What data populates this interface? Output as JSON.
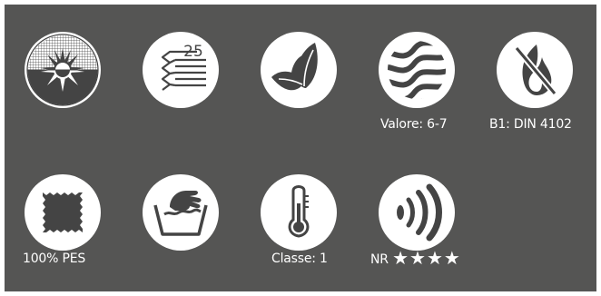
{
  "features": {
    "uv_protection": {
      "icon": "sun-mesh-icon"
    },
    "pleats": {
      "icon": "pleat-icon",
      "value": "25"
    },
    "eco": {
      "icon": "leaf-icon"
    },
    "light_fastness": {
      "icon": "waves-icon",
      "caption": "Valore: 6-7"
    },
    "fire_rating": {
      "icon": "fire-icon",
      "caption": "B1: DIN 4102"
    },
    "material": {
      "icon": "fabric-swatch-icon",
      "caption": "100% PES"
    },
    "washing": {
      "icon": "hand-wash-icon"
    },
    "thermal": {
      "icon": "thermometer-icon",
      "caption": "Classe: 1"
    },
    "acoustic": {
      "icon": "sound-icon",
      "caption_prefix": "NR",
      "stars": "★★★★"
    }
  },
  "colors": {
    "background": "#555554",
    "icon_circle": "#ffffff",
    "icon_glyph": "#444444",
    "caption": "#ffffff"
  }
}
